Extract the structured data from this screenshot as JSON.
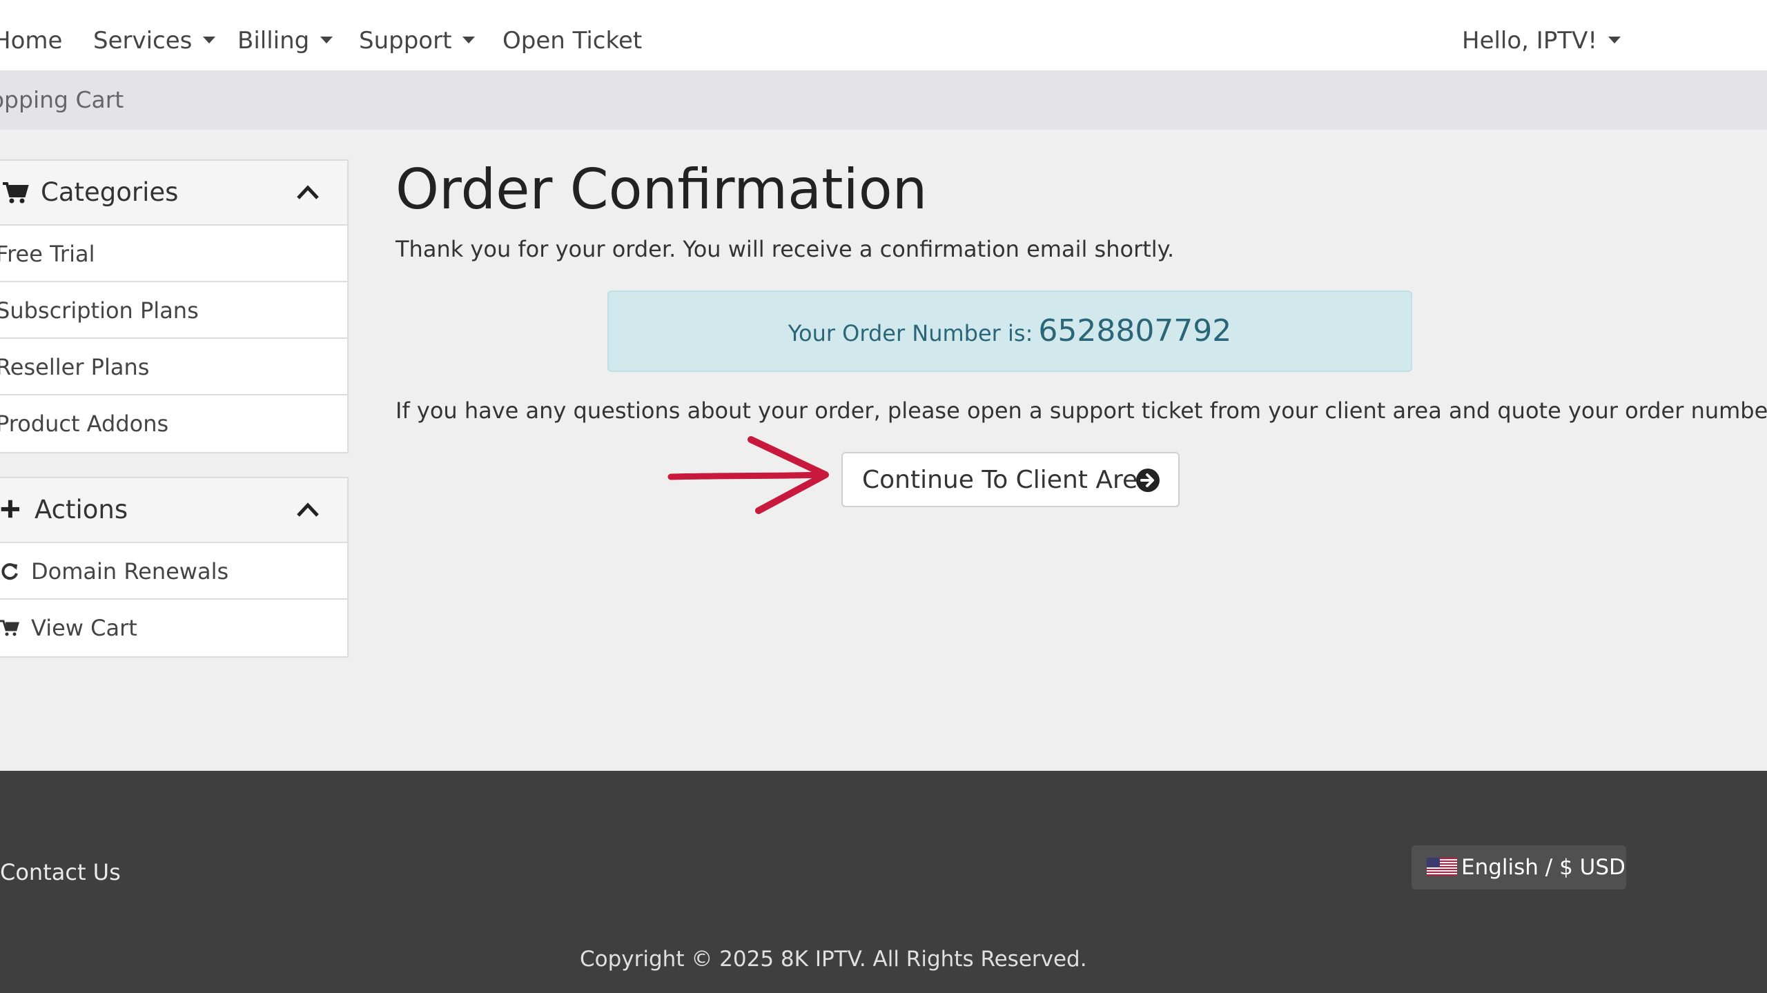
{
  "nav": {
    "items": [
      {
        "label": "Home",
        "has_dropdown": false
      },
      {
        "label": "Services",
        "has_dropdown": true
      },
      {
        "label": "Billing",
        "has_dropdown": true
      },
      {
        "label": "Support",
        "has_dropdown": true
      },
      {
        "label": "Open Ticket",
        "has_dropdown": false
      }
    ],
    "user_menu": "Hello, IPTV!"
  },
  "breadcrumb": "Shopping Cart",
  "sidebar": {
    "categories": {
      "title": "Categories",
      "items": [
        "Free Trial",
        "Subscription Plans",
        "Reseller Plans",
        "Product Addons"
      ]
    },
    "actions": {
      "title": "Actions",
      "items": [
        {
          "label": "Domain Renewals",
          "icon": "refresh-icon"
        },
        {
          "label": "View Cart",
          "icon": "cart-icon"
        }
      ]
    }
  },
  "main": {
    "title": "Order Confirmation",
    "thanks": "Thank you for your order. You will receive a confirmation email shortly.",
    "order_label": "Your Order Number is:",
    "order_number": "6528807792",
    "questions": "If you have any questions about your order, please open a support ticket from your client area and quote your order number.",
    "continue_label": "Continue To Client Area"
  },
  "footer": {
    "contact": "Contact Us",
    "language": "English / $ USD",
    "copyright": "Copyright © 2025 8K IPTV. All Rights Reserved."
  },
  "colors": {
    "order_box_bg": "#d1e8ed",
    "order_text": "#2a6677",
    "footer_bg": "#3f3f3f",
    "annotation_arrow": "#c8193c"
  }
}
